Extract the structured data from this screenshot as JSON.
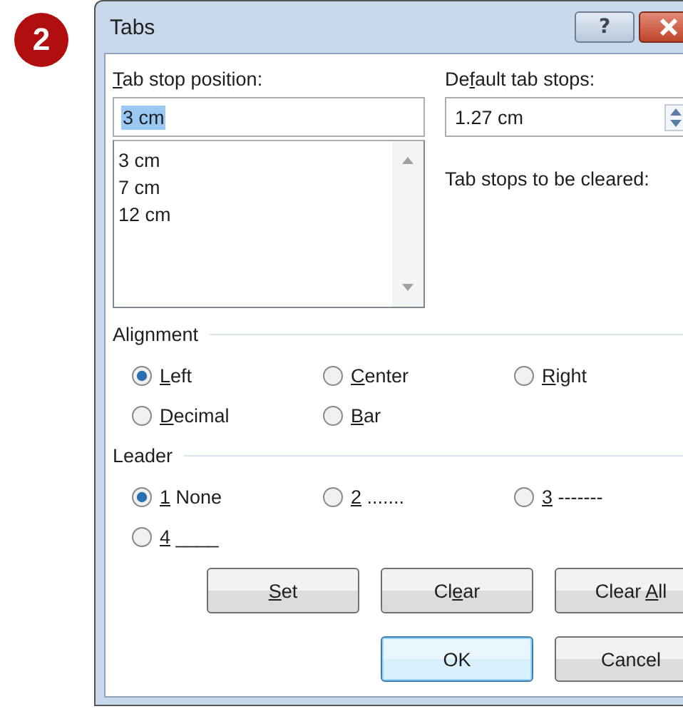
{
  "step_badge": "2",
  "window": {
    "title": "Tabs",
    "help_button": "?"
  },
  "tab_stop_position": {
    "label": {
      "key": "T",
      "post": "ab stop position:"
    },
    "value": "3 cm",
    "value_selected": true,
    "items": [
      "3 cm",
      "7 cm",
      "12 cm"
    ]
  },
  "default_tab_stops": {
    "label": {
      "pre": "De",
      "key": "f",
      "post": "ault tab stops:"
    },
    "value": "1.27 cm"
  },
  "tab_stops_to_be_cleared": "Tab stops to be cleared:",
  "alignment": {
    "title": "Alignment",
    "options": [
      {
        "key": "L",
        "post": "eft",
        "selected": true
      },
      {
        "key": "C",
        "post": "enter",
        "selected": false
      },
      {
        "key": "R",
        "post": "ight",
        "selected": false
      },
      {
        "key": "D",
        "post": "ecimal",
        "selected": false
      },
      {
        "key": "B",
        "post": "ar",
        "selected": false
      }
    ]
  },
  "leader": {
    "title": "Leader",
    "options": [
      {
        "key": "1",
        "post": " None",
        "selected": true
      },
      {
        "key": "2",
        "post": " .......",
        "selected": false
      },
      {
        "key": "3",
        "post": " -------",
        "selected": false
      },
      {
        "key": "4",
        "post": " ____",
        "selected": false
      }
    ]
  },
  "button_rows": [
    [
      {
        "key": "S",
        "post": "et",
        "default": false
      },
      {
        "pre": "Cl",
        "key": "e",
        "post": "ar",
        "default": false
      },
      {
        "pre": "Clear ",
        "key": "A",
        "post": "ll",
        "default": false
      }
    ],
    [
      {
        "pre": "OK",
        "default": true
      },
      {
        "pre": "Cancel",
        "default": false
      }
    ]
  ]
}
